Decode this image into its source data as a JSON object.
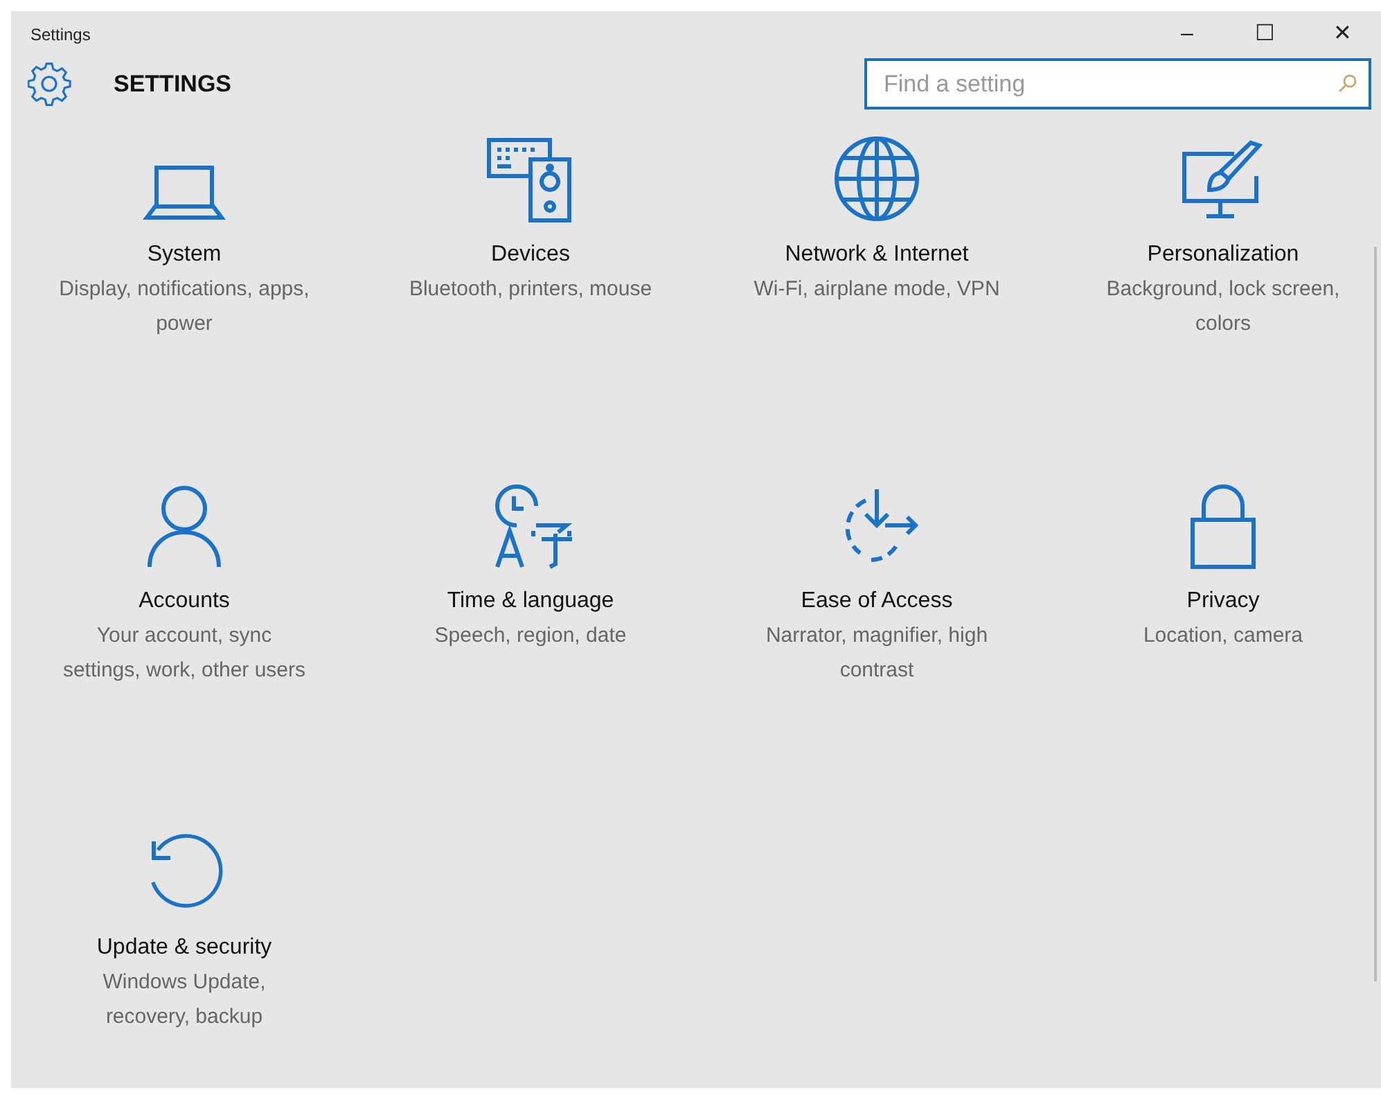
{
  "window": {
    "title": "Settings",
    "controls": [
      "–",
      "☐",
      "✕"
    ]
  },
  "header": {
    "title": "SETTINGS"
  },
  "search": {
    "placeholder": "Find a setting"
  },
  "tiles": [
    {
      "title": "System",
      "description": "Display, notifications, apps, power"
    },
    {
      "title": "Devices",
      "description": "Bluetooth, printers, mouse"
    },
    {
      "title": "Network & Internet",
      "description": "Wi-Fi, airplane mode, VPN"
    },
    {
      "title": "Personalization",
      "description": "Background, lock screen, colors"
    },
    {
      "title": "Accounts",
      "description": "Your account, sync settings, work, other users"
    },
    {
      "title": "Time & language",
      "description": "Speech, region, date"
    },
    {
      "title": "Ease of Access",
      "description": "Narrator, magnifier, high contrast"
    },
    {
      "title": "Privacy",
      "description": "Location, camera"
    },
    {
      "title": "Update & security",
      "description": "Windows Update, recovery, backup"
    }
  ]
}
